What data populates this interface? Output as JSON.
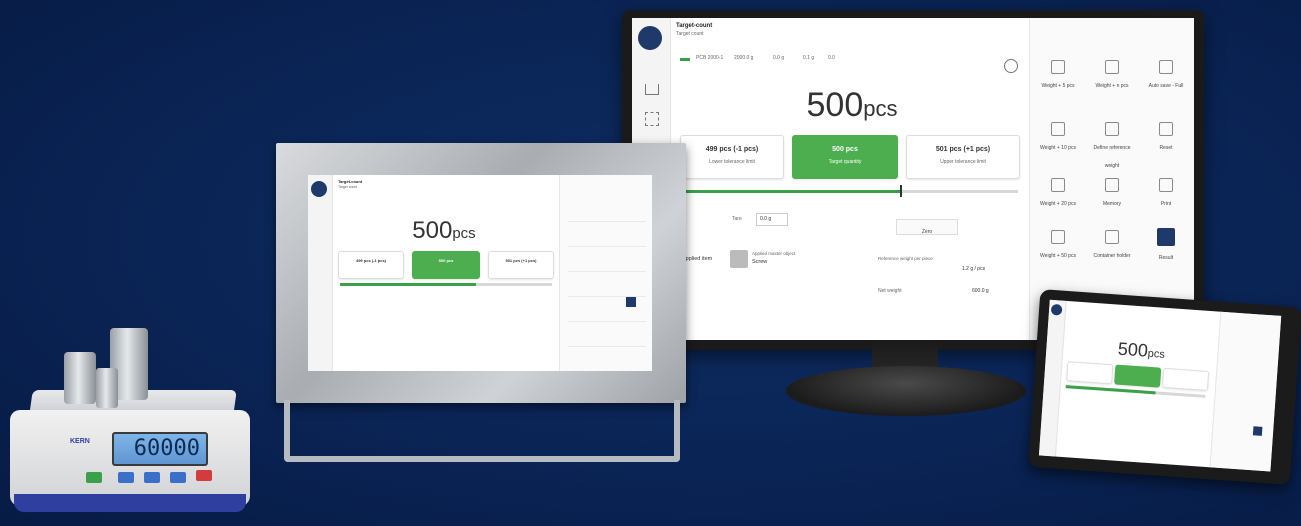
{
  "app": {
    "title": "Target-count",
    "subtitle": "Target count",
    "main_value": "500",
    "main_unit": "pcs",
    "lower_value": "499 pcs (-1 pcs)",
    "lower_label": "Lower tolerance limit",
    "target_value": "500 pcs",
    "target_label": "Target quantity",
    "upper_value": "501 pcs (+1 pcs)",
    "upper_label": "Upper tolerance limit",
    "tare_label": "Tare",
    "tare_value": "0.0 g",
    "zero_label": "Zero",
    "applied_label": "Applied item",
    "applied_sub": "Applied master object",
    "applied_name": "Screw",
    "ref_label": "Reference weight per piece",
    "ref_value": "1.2 g / pcs",
    "net_label": "Net weight",
    "net_value": "600.0 g",
    "info_model": "PCB 2000-1",
    "info_max": "2000.0 g",
    "info_d": "0.0 g",
    "info_e": "0.1 g",
    "info_min": "0.0",
    "tiles": [
      {
        "label": "Weight + 5 pcs"
      },
      {
        "label": "Weight + n pcs"
      },
      {
        "label": "Auto save - Full"
      },
      {
        "label": "Weight + 10 pcs"
      },
      {
        "label": "Define reference weight"
      },
      {
        "label": "Reset"
      },
      {
        "label": "Weight + 20 pcs"
      },
      {
        "label": "Memory"
      },
      {
        "label": "Print"
      },
      {
        "label": "Weight + 50 pcs"
      },
      {
        "label": "Container holder"
      },
      {
        "label": "Result"
      }
    ]
  },
  "scale": {
    "display": "60000",
    "brand": "KERN"
  },
  "colors": {
    "background": "#0a2455",
    "accent_green": "#4cae4f",
    "dark_tile": "#1f3a6a"
  }
}
